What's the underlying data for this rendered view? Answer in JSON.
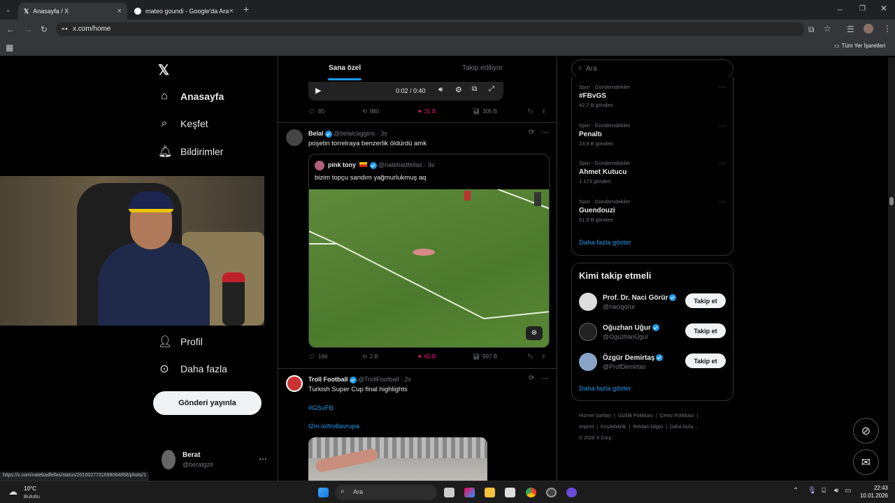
{
  "browser": {
    "tabs": [
      {
        "title": "Anasayfa / X",
        "active": true
      },
      {
        "title": "mateo goundi - Google'da Ara",
        "active": false
      }
    ],
    "new_tab": "+",
    "url": "x.com/home",
    "bookmarks_label": "Tüm Yer İşaretleri",
    "status_url": "https://x.com/natebadfellas/status/2010027731699064858/photo/1"
  },
  "left_nav": {
    "items": [
      {
        "label": "Anasayfa",
        "icon": "home-icon"
      },
      {
        "label": "Keşfet",
        "icon": "search-icon"
      },
      {
        "label": "Bildirimler",
        "icon": "bell-icon"
      },
      {
        "label": "Profil",
        "icon": "person-icon"
      },
      {
        "label": "Daha fazla",
        "icon": "more-circle-icon"
      }
    ],
    "post_button": "Gönderi yayınla",
    "account": {
      "name": "Berat",
      "handle": "@beratgzlr"
    }
  },
  "feed": {
    "tabs": [
      "Sana özel",
      "Takip ediliyor"
    ],
    "video_controls": {
      "time": "0:02 / 0:40"
    },
    "post0_stats": {
      "replies": "85",
      "reposts": "980",
      "likes": "21 B",
      "views": "305 B"
    },
    "post1": {
      "name": "Belal",
      "handle": "@belalcaggins",
      "time": "· 3s",
      "text": "poşetin torrelraya benzerlik öldürdü amk",
      "quote": {
        "name": "pink tony",
        "handle": "@natebadfellas",
        "time": "· 3s",
        "text": "bizim topçu sandım yağmurlukmuş aq"
      },
      "stats": {
        "replies": "166",
        "reposts": "2 B",
        "likes": "60 B",
        "views": "997 B"
      }
    },
    "post2": {
      "name": "Troll Football",
      "handle": "@TrollFootball",
      "time": "· 2s",
      "text": "Turkish Super Cup final highlights",
      "hashtag": "#GSvFB",
      "link": "t2m.io/trollavrupa"
    }
  },
  "sidebar": {
    "search_placeholder": "Ara",
    "trends": [
      {
        "category": "Spor · Gündemdekiler",
        "title": "#FBvGS",
        "count": "42,7 B gönderi"
      },
      {
        "category": "Spor · Gündemdekiler",
        "title": "Penaltı",
        "count": "23,9 B gönderi"
      },
      {
        "category": "Spor · Gündemdekiler",
        "title": "Ahmet Kutucu",
        "count": "1.173 gönderi"
      },
      {
        "category": "Spor · Gündemdekiler",
        "title": "Guendouzi",
        "count": "61,9 B gönderi"
      }
    ],
    "show_more": "Daha fazla göster",
    "who_to_follow": {
      "title": "Kimi takip etmeli",
      "users": [
        {
          "name": "Prof. Dr. Naci Görür",
          "handle": "@nacigorur"
        },
        {
          "name": "Oğuzhan Uğur",
          "handle": "@OguzhanUgur"
        },
        {
          "name": "Özgür Demirtaş",
          "handle": "@ProfDemirtas"
        }
      ],
      "follow_label": "Takip et",
      "show_more": "Daha fazla göster"
    },
    "footer": {
      "links": [
        "Hizmet Şartları",
        "Gizlilik Politikası",
        "Çerez Politikası",
        "Imprint",
        "Erişilebilirlik",
        "Reklam bilgisi",
        "Daha fazla ..."
      ],
      "copyright": "© 2026 X Corp."
    }
  },
  "taskbar": {
    "weather_temp": "10°C",
    "weather_desc": "Bulutlu",
    "search_label": "Ara",
    "time": "22:43",
    "date": "10.01.2026"
  }
}
